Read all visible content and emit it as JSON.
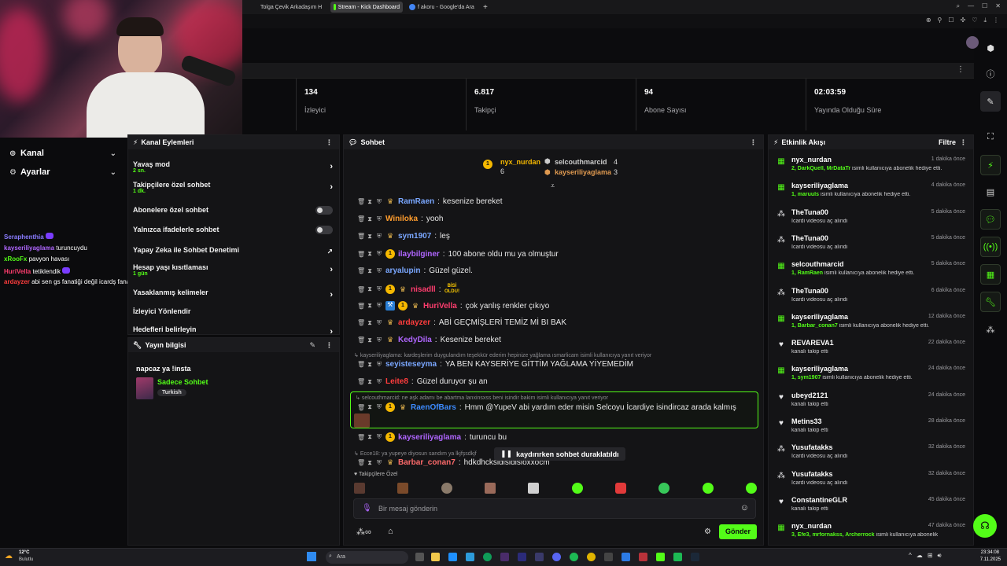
{
  "browser": {
    "tabs": [
      {
        "label": "Tolga Çevik Arkadaşım H",
        "color": "#e62117"
      },
      {
        "label": "Stream - Kick Dashboard",
        "color": "#53fc18"
      },
      {
        "label": "f akoru - Google'da Ara",
        "color": "#4285f4"
      }
    ],
    "new_tab": "+"
  },
  "overlay_chat": [
    {
      "user": "Seraphenthia",
      "color": "#8a7cff",
      "text": ""
    },
    {
      "user": "kayseriliyaglama",
      "color": "#b066ff",
      "text": "turuncuydu"
    },
    {
      "user": "xRooFx",
      "color": "#53fc18",
      "text": "pavyon havası"
    },
    {
      "user": "HuriVella",
      "color": "#ff3d6e",
      "text": "tetiklendik"
    },
    {
      "user": "ardayzer",
      "color": "#ff3d3d",
      "text": "abi sen gs fanatiği değil icardş fanatiğisin çok doğru tespit yaptım @yupev"
    }
  ],
  "leftnav": {
    "kanal": "Kanal",
    "ayarlar": "Ayarlar"
  },
  "stats": [
    {
      "value": "134",
      "label": "İzleyici"
    },
    {
      "value": "6.817",
      "label": "Takipçi"
    },
    {
      "value": "94",
      "label": "Abone Sayısı"
    },
    {
      "value": "02:03:59",
      "label": "Yayında Olduğu Süre"
    }
  ],
  "kanal_eylemleri": {
    "title": "Kanal Eylemleri",
    "rows": [
      {
        "label": "Yavaş mod",
        "sub": "2 sn."
      },
      {
        "label": "Takipçilere özel sohbet",
        "sub": "1 dk."
      },
      {
        "label": "Abonelere özel sohbet",
        "sub": ""
      },
      {
        "label": "Yalnızca ifadelerle sohbet",
        "sub": ""
      },
      {
        "label": "Yapay Zeka ile Sohbet Denetimi",
        "sub": ""
      },
      {
        "label": "Hesap yaşı kısıtlaması",
        "sub": "1 gün"
      },
      {
        "label": "Yasaklanmış kelimeler",
        "sub": ""
      },
      {
        "label": "İzleyici Yönlendir",
        "sub": ""
      },
      {
        "label": "Hedefleri belirleyin",
        "sub": ""
      }
    ]
  },
  "yayin_bilgisi": {
    "title": "Yayın bilgisi",
    "stream_title": "napcaz ya !insta",
    "category": "Sadece Sohbet",
    "tag": "Turkish"
  },
  "chat": {
    "title": "Sohbet",
    "pinned": [
      {
        "name": "nyx_nurdan",
        "count": "6"
      },
      {
        "name": "selcouthmarcid",
        "count": "4"
      },
      {
        "name": "kayseriliyaglama",
        "count": "3"
      }
    ],
    "messages": [
      {
        "user": "RamRaen",
        "color": "#7aa7ff",
        "text": "kesenize bereket"
      },
      {
        "user": "Winiloka",
        "color": "#ff9d2e",
        "text": "yooh"
      },
      {
        "user": "sym1907",
        "color": "#7aa7ff",
        "text": "leş"
      },
      {
        "user": "ilaybilginer",
        "color": "#b066ff",
        "text": "100 abone oldu mu ya olmuştur"
      },
      {
        "user": "aryalupin",
        "color": "#7aa7ff",
        "text": "Güzel güzel."
      },
      {
        "user": "nisadll",
        "color": "#ff3d6e",
        "text": ""
      },
      {
        "user": "HuriVella",
        "color": "#ff3d6e",
        "text": "çok yanlış renkler çıkıyo"
      },
      {
        "user": "ardayzer",
        "color": "#ff3d3d",
        "text": "ABİ GEÇMİŞLERİ TEMİZ Mİ BI BAK"
      },
      {
        "user": "KedyDila",
        "color": "#b066ff",
        "text": "Kesenize bereket"
      },
      {
        "user": "seyisteseyma",
        "color": "#7aa7ff",
        "text": "YA BEN KAYSERİYE GİTTİM YAĞLAMA YİYEMEDİM"
      },
      {
        "user": "Leite8",
        "color": "#ff3d3d",
        "text": "Güzel duruyor şu an"
      },
      {
        "user": "RaenOfBars",
        "color": "#3d8bff",
        "text": "Hmm @YupeV abi yardım eder misin Selcoyu İcardiye isindircaz arada kalmış"
      },
      {
        "user": "kayseriliyaglama",
        "color": "#b066ff",
        "text": "turuncu bu"
      },
      {
        "user": "Barbar_conan7",
        "color": "#ff6b6b",
        "text": "hdkdhcksidisidisioxxocm"
      }
    ],
    "reply1": "kayseriliyaglama: kardeşlerim duygulandım teşekkür ederim hepinize yağlama ısmarlicam isimli kullanıcıya yanıt veriyor",
    "reply2": "selcouthmarcid: ne aşk adamı be abartma lanxinsxss beni isindir bakim isimli kullanıcıya yanıt veriyor",
    "reply3": "Ecce18: ya yupeye diyosun sandım ya lkjfşsdkjf",
    "paused": "kaydırırken sohbet duraklatıldı",
    "takipci_ozel": "Takipçilere Özel",
    "placeholder": "Bir mesaj gönderin",
    "send": "Gönder",
    "nisadll_badge": "BİSİ OLDU!"
  },
  "activity": {
    "title": "Etkinlik Akışı",
    "filter": "Filtre",
    "items": [
      {
        "name": "nyx_nurdan",
        "time": "1 dakika önce",
        "desc": "2, DarkQuell, MrDataTr isimli kullanıcıya abonelik hediye etti.",
        "icon": "gift"
      },
      {
        "name": "kayseriliyaglama",
        "time": "4 dakika önce",
        "desc": "1, maruuls isimli kullanıcıya abonelik hediye etti.",
        "icon": "gift"
      },
      {
        "name": "TheTuna00",
        "time": "5 dakika önce",
        "desc": "İcardi videosu aç alındı",
        "icon": "reward"
      },
      {
        "name": "TheTuna00",
        "time": "5 dakika önce",
        "desc": "İcardi videosu aç alındı",
        "icon": "reward"
      },
      {
        "name": "selcouthmarcid",
        "time": "5 dakika önce",
        "desc": "1, RamRaen isimli kullanıcıya abonelik hediye etti.",
        "icon": "gift"
      },
      {
        "name": "TheTuna00",
        "time": "6 dakika önce",
        "desc": "İcardi videosu aç alındı",
        "icon": "reward"
      },
      {
        "name": "kayseriliyaglama",
        "time": "12 dakika önce",
        "desc": "1, Barbar_conan7 isimli kullanıcıya abonelik hediye etti.",
        "icon": "gift"
      },
      {
        "name": "REVAREVA1",
        "time": "22 dakika önce",
        "desc": "kanalı takip etti",
        "icon": "heart"
      },
      {
        "name": "kayseriliyaglama",
        "time": "24 dakika önce",
        "desc": "1, sym1907 isimli kullanıcıya abonelik hediye etti.",
        "icon": "gift"
      },
      {
        "name": "ubeyd2121",
        "time": "24 dakika önce",
        "desc": "kanalı takip etti",
        "icon": "heart"
      },
      {
        "name": "Metins33",
        "time": "28 dakika önce",
        "desc": "kanalı takip etti",
        "icon": "heart"
      },
      {
        "name": "Yusufatakks",
        "time": "32 dakika önce",
        "desc": "İcardi videosu aç alındı",
        "icon": "reward"
      },
      {
        "name": "Yusufatakks",
        "time": "32 dakika önce",
        "desc": "İcardi videosu aç alındı",
        "icon": "reward"
      },
      {
        "name": "ConstantineGLR",
        "time": "45 dakika önce",
        "desc": "kanalı takip etti",
        "icon": "heart"
      },
      {
        "name": "nyx_nurdan",
        "time": "47 dakika önce",
        "desc": "3, Efe3, mrfornakss, Archerrock isimli kullanıcıya abonelik",
        "icon": "gift"
      }
    ]
  },
  "taskbar": {
    "weather_temp": "12°C",
    "weather_desc": "Bulutlu",
    "search": "Ara",
    "time": "23:34:08",
    "date": "7.11.2025"
  }
}
